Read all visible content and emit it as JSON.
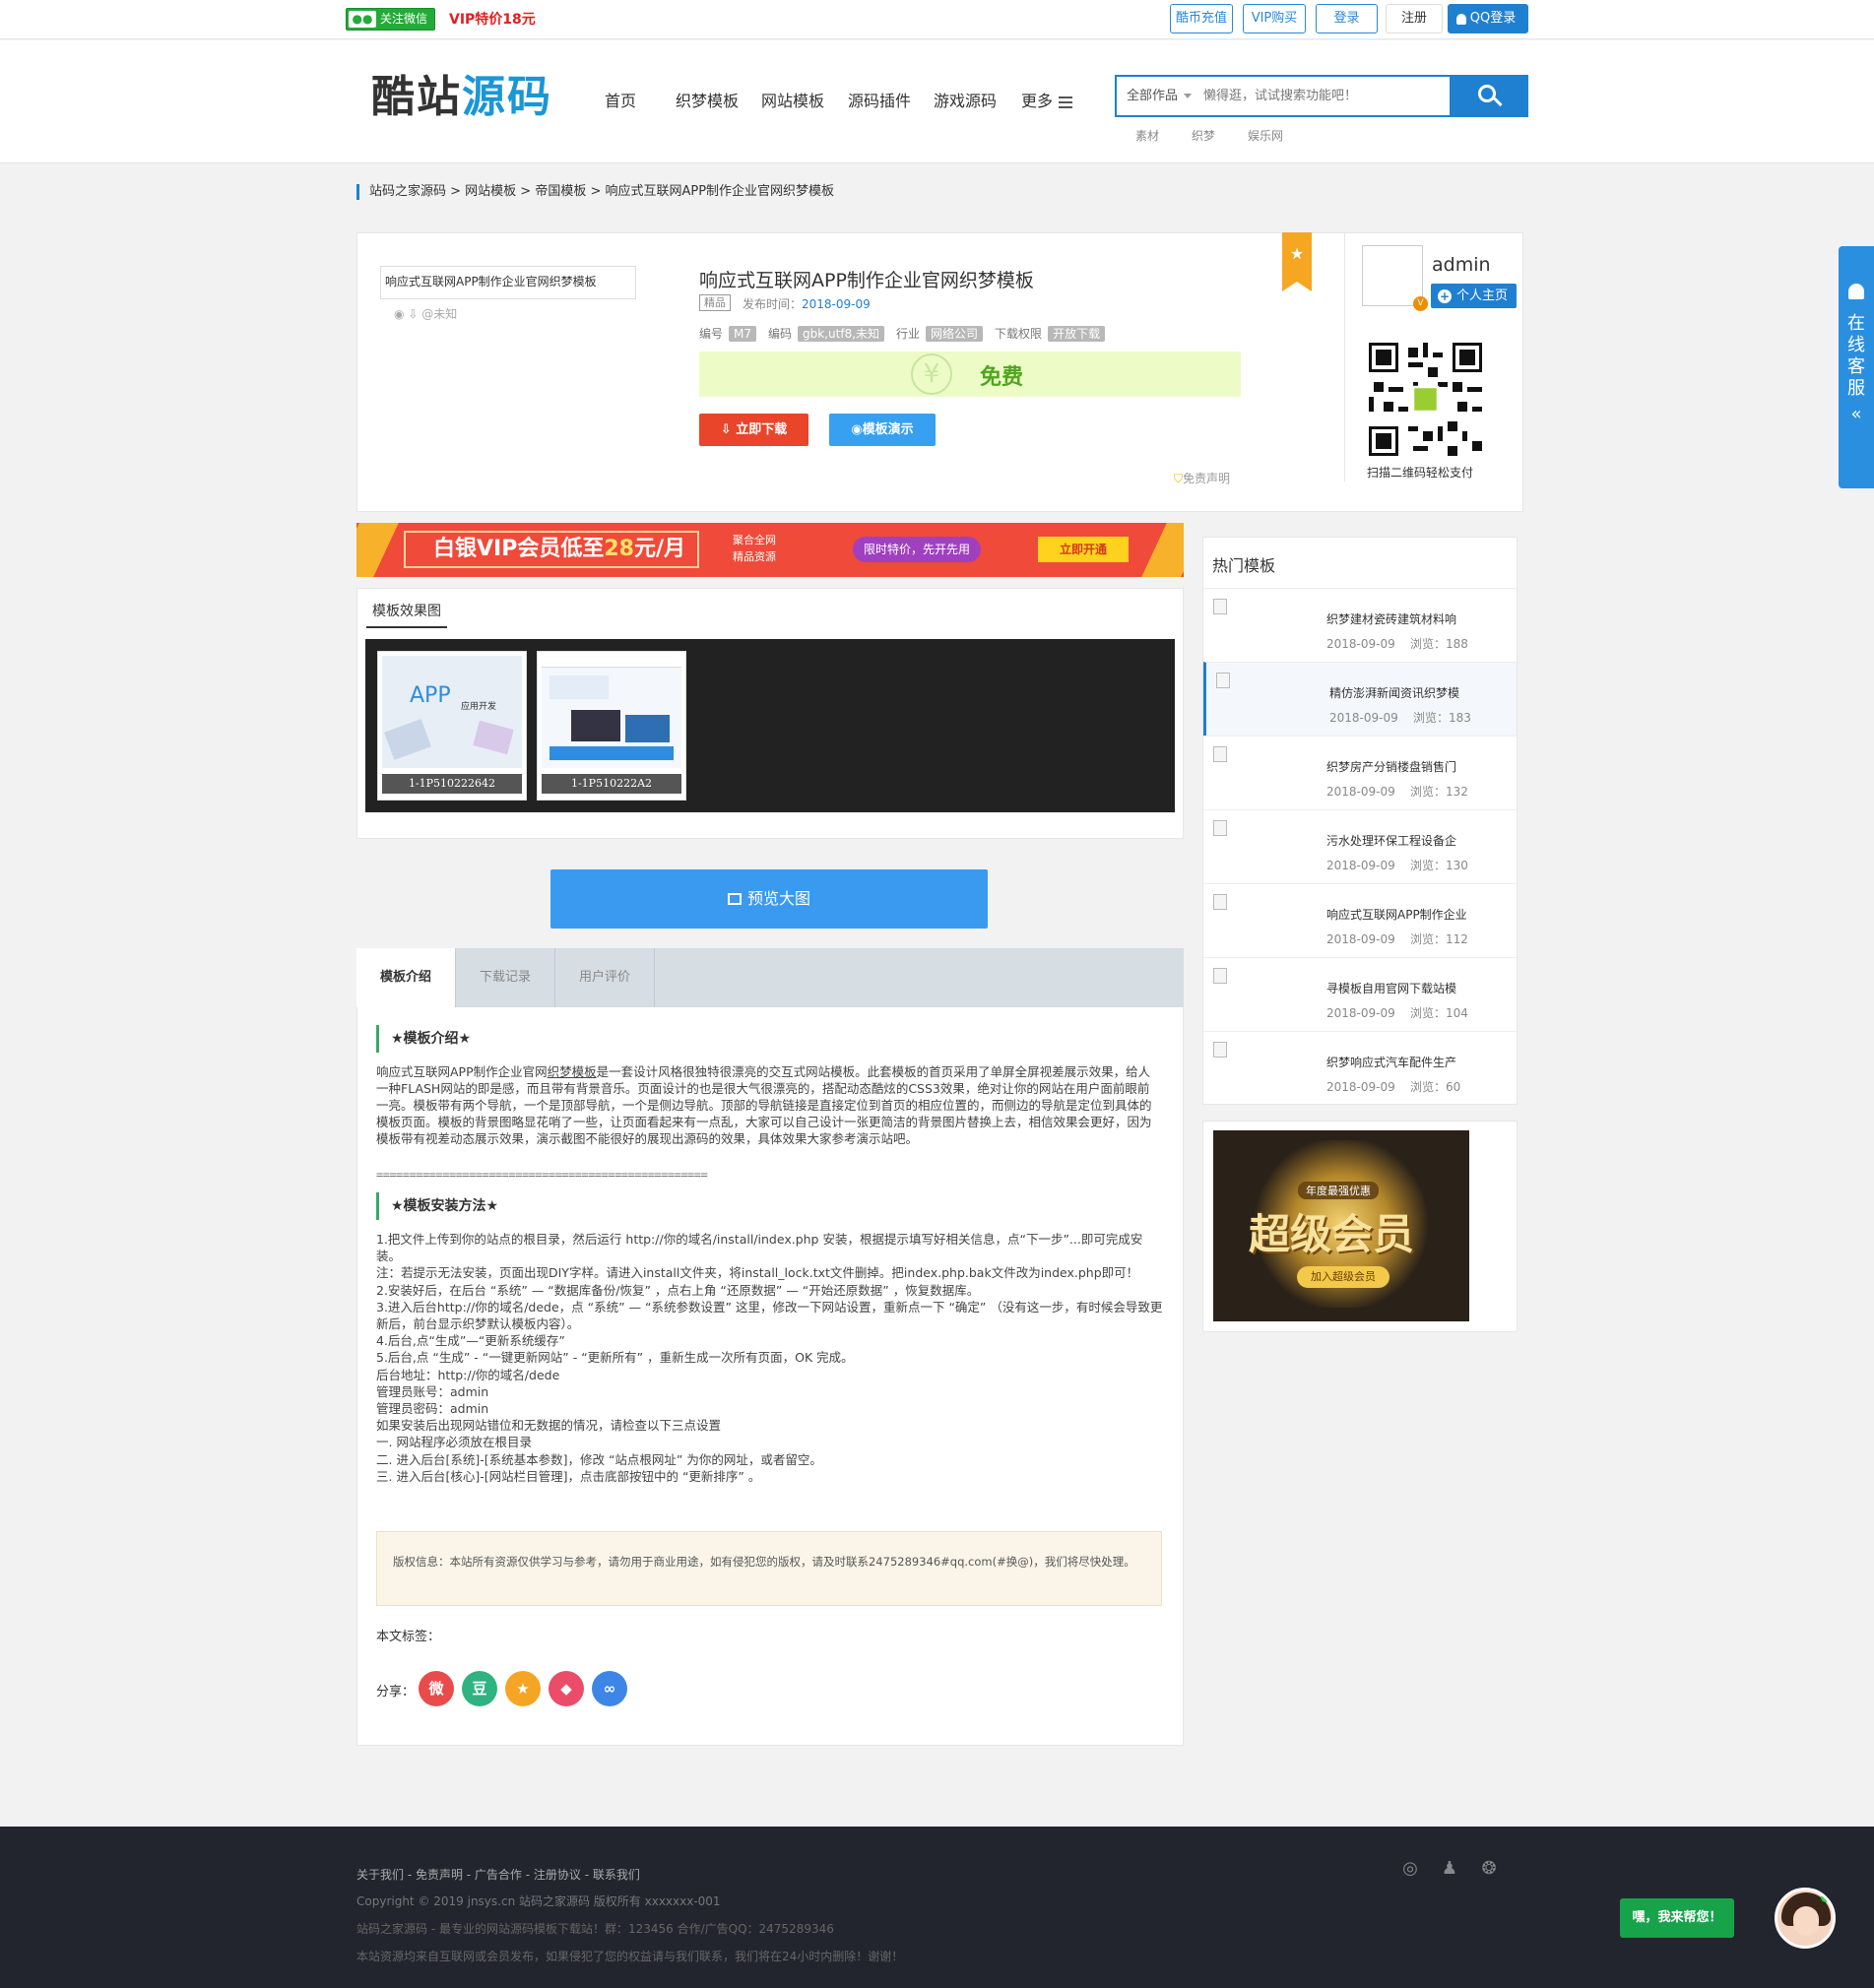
{
  "topbar": {
    "wechat_label": "关注微信",
    "wechat_icon": "wechat-icon",
    "vip_promo": "VIP特价18元",
    "buttons": [
      "酷币充值",
      "VIP购买",
      "登录",
      "注册",
      "QQ登录"
    ]
  },
  "header": {
    "logo_a": "酷站",
    "logo_b": "源码",
    "nav": [
      "首页",
      "织梦模板",
      "网站模板",
      "源码插件",
      "游戏源码",
      "更多"
    ],
    "search": {
      "category": "全部作品",
      "placeholder": "懒得逛，试试搜索功能吧！"
    },
    "hot_keywords": [
      "素材",
      "织梦",
      "娱乐网"
    ]
  },
  "breadcrumb": "站码之家源码 > 网站模板 > 帝国模板 > 响应式互联网APP制作企业官网织梦模板",
  "product": {
    "thumb_alt": "响应式互联网APP制作企业官网织梦模板",
    "stats": "@未知",
    "title": "响应式互联网APP制作企业官网织梦模板",
    "badge": "精品",
    "pubtime_label": "发布时间：",
    "pubtime": "2018-09-09",
    "attrs": [
      {
        "k": "编号",
        "v": "M7"
      },
      {
        "k": "编码",
        "v": "gbk,utf8,未知"
      },
      {
        "k": "行业",
        "v": "网络公司"
      },
      {
        "k": "下载权限",
        "v": "开放下载"
      }
    ],
    "price": "免费",
    "yen": "¥",
    "download": "立即下载",
    "demo": "模板演示",
    "disclaimer": "免责声明"
  },
  "author": {
    "name": "admin",
    "home": "个人主页",
    "qr_caption": "扫描二维码轻松支付"
  },
  "vip_banner": {
    "main_a": "白银VIP会员低至",
    "main_b": "28",
    "main_c": "元/月",
    "sub1": "聚合全网",
    "sub2": "精品资源",
    "pill": "限时特价，先开先用",
    "open": "立即开通"
  },
  "gallery": {
    "tab": "模板效果图",
    "items": [
      "1-1P510222642",
      "1-1P510222A2"
    ],
    "app_label": "APP",
    "app_sub": "应用开发"
  },
  "preview_button": "预览大图",
  "tabs": [
    "模板介绍",
    "下载记录",
    "用户评价"
  ],
  "intro": {
    "h1": "★模板介绍★",
    "p1_pre": "响应式互联网APP制作企业官网",
    "p1_link": "织梦模板",
    "p1_post": "是一套设计风格很独特很漂亮的交互式网站模板。此套模板的首页采用了单屏全屏视差展示效果，给人一种FLASH网站的即是感，而且带有背景音乐。页面设计的也是很大气很漂亮的，搭配动态酷炫的CSS3效果，绝对让你的网站在用户面前眼前一亮。模板带有两个导航，一个是顶部导航，一个是侧边导航。顶部的导航链接是直接定位到首页的相应位置的，而侧边的导航是定位到具体的模板页面。模板的背景图略显花哨了一些，让页面看起来有一点乱，大家可以自己设计一张更简洁的背景图片替换上去，相信效果会更好，因为模板带有视差动态展示效果，演示截图不能很好的展现出源码的效果，具体效果大家参考演示站吧。",
    "dashes": "==================================================",
    "h2": "★模板安装方法★",
    "steps": [
      "1.把文件上传到你的站点的根目录，然后运行 http://你的域名/install/index.php 安装，根据提示填写好相关信息，点“下一步”...即可完成安装。",
      "注：若提示无法安装，页面出现DIY字样。请进入install文件夹，将install_lock.txt文件删掉。把index.php.bak文件改为index.php即可！",
      "2.安装好后，在后台 “系统” — “数据库备份/恢复” ，点右上角 “还原数据” — “开始还原数据” ，恢复数据库。",
      "3.进入后台http://你的域名/dede，点 “系统” — “系统参数设置” 这里，修改一下网站设置，重新点一下 “确定” （没有这一步，有时候会导致更新后，前台显示织梦默认模板内容）。",
      "4.后台,点“生成”—“更新系统缓存”",
      "5.后台,点 “生成” - “一键更新网站” - “更新所有” ，重新生成一次所有页面，OK 完成。",
      "后台地址：http://你的域名/dede",
      "管理员账号：admin",
      "管理员密码：admin",
      "如果安装后出现网站错位和无数据的情况，请检查以下三点设置",
      "一. 网站程序必须放在根目录",
      "二. 进入后台[系统]-[系统基本参数]，修改 “站点根网址” 为你的网址，或者留空。",
      "三. 进入后台[核心]-[网站栏目管理]，点击底部按钮中的 “更新排序” 。"
    ],
    "copyright": "版权信息：本站所有资源仅供学习与参考，请勿用于商业用途，如有侵犯您的版权，请及时联系2475289346#qq.com(#换@)，我们将尽快处理。",
    "tags_label": "本文标签：",
    "share_label": "分享："
  },
  "hot": {
    "title": "热门模板",
    "items": [
      {
        "t": "织梦建材瓷砖建筑材料响",
        "d": "2018-09-09",
        "v": "浏览：188"
      },
      {
        "t": "精仿澎湃新闻资讯织梦模",
        "d": "2018-09-09",
        "v": "浏览：183"
      },
      {
        "t": "织梦房产分销楼盘销售门",
        "d": "2018-09-09",
        "v": "浏览：132"
      },
      {
        "t": "污水处理环保工程设备企",
        "d": "2018-09-09",
        "v": "浏览：130"
      },
      {
        "t": "响应式互联网APP制作企业",
        "d": "2018-09-09",
        "v": "浏览：112"
      },
      {
        "t": "寻模板自用官网下载站模",
        "d": "2018-09-09",
        "v": "浏览：104"
      },
      {
        "t": "织梦响应式汽车配件生产",
        "d": "2018-09-09",
        "v": "浏览：60"
      }
    ]
  },
  "supervip": {
    "small": "年度最强优惠",
    "big": "超级会员",
    "join": "加入超级会员"
  },
  "float_service": "在线客服",
  "footer": {
    "links": "关于我们 - 免责声明 - 广告合作 - 注册协议 - 联系我们",
    "copyright": "Copyright © 2019 jnsys.cn 站码之家源码 版权所有 xxxxxxx-001",
    "line3": "站码之家源码 - 最专业的网站源码模板下载站！群：123456 合作/广告QQ：2475289346",
    "line4": "本站资源均来自互联网或会员发布，如果侵犯了您的权益请与我们联系，我们将在24小时内删除！谢谢！",
    "help": "嘿，我来帮您！"
  },
  "colors": {
    "brand": "#1f80d1",
    "download": "#e8452a",
    "free": "#4fa520",
    "vip": "#ef4a3a"
  }
}
